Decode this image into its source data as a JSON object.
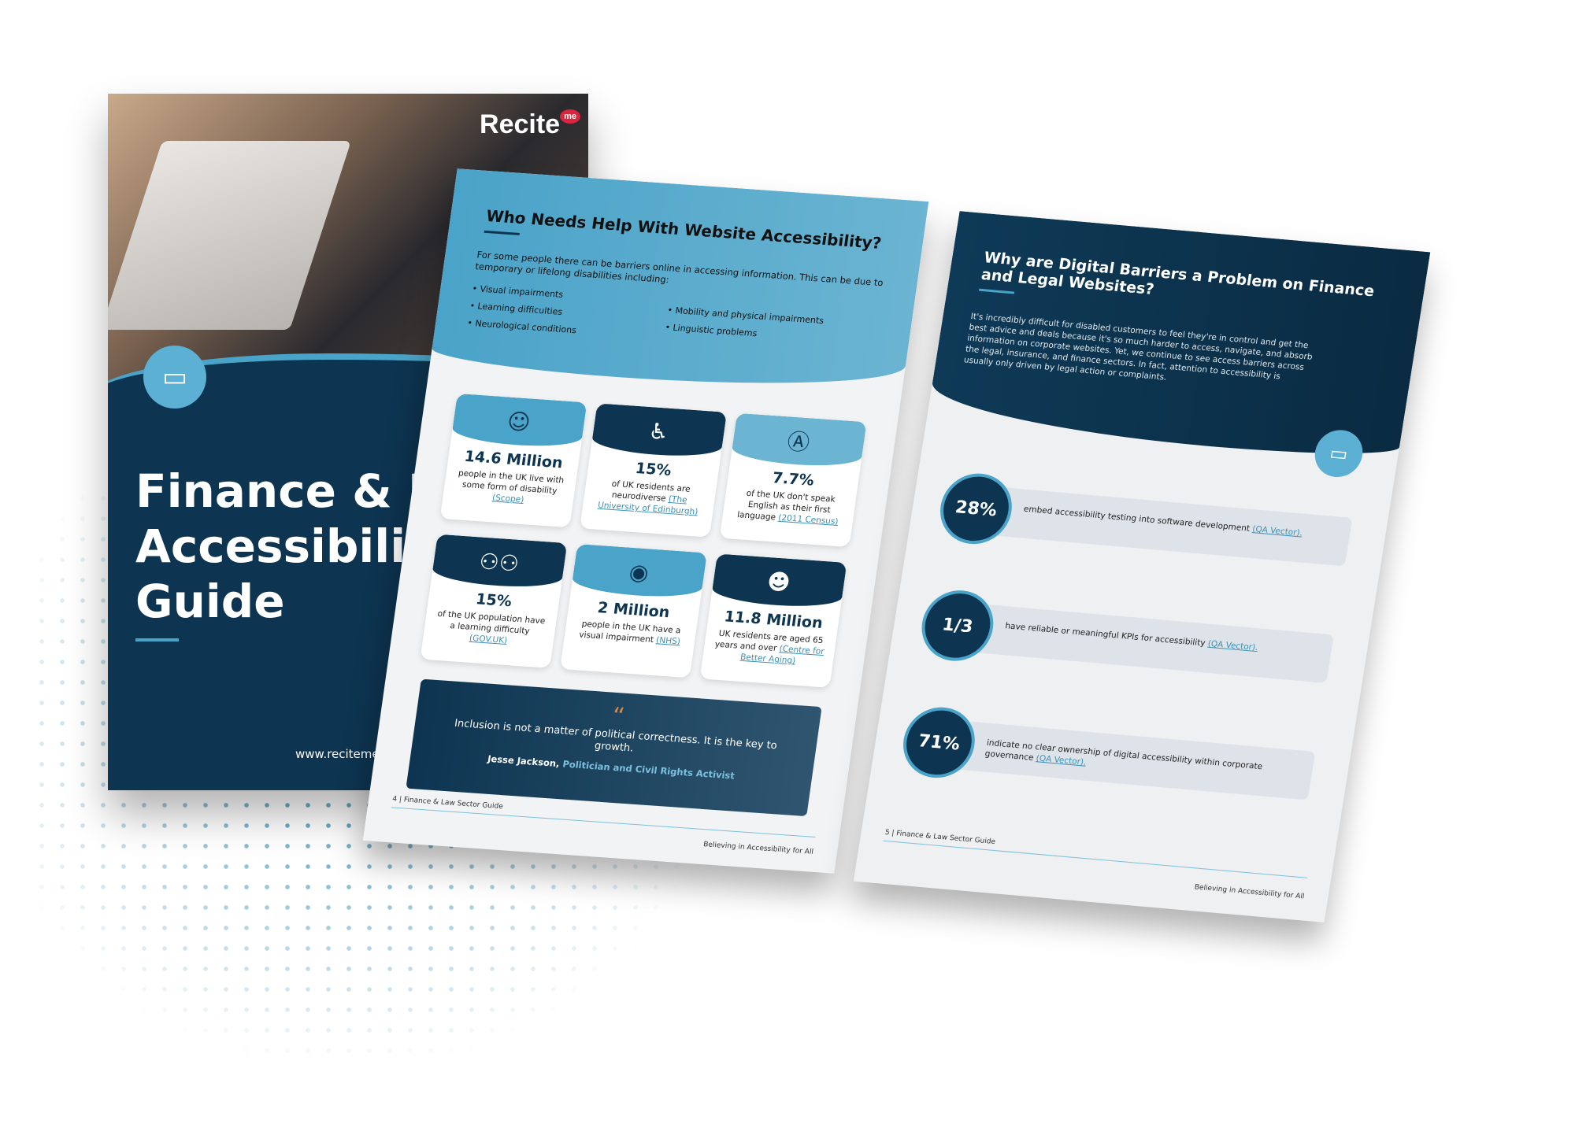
{
  "colors": {
    "navy": "#0d3450",
    "accent": "#4aa3c8",
    "quote_mark": "#d18a4a",
    "logo_red": "#d7263d"
  },
  "cover": {
    "logo": "Recite",
    "logo_badge": "me",
    "title": "Finance & L\nAccessibility\nGuide",
    "url": "www.reciteme.co",
    "badge_icon": "money-icon"
  },
  "left_page": {
    "title": "Who Needs Help With Website Accessibility?",
    "intro": "For some people there can be barriers online in accessing information. This can be due to temporary or lifelong disabilities including:",
    "bullets_col1": [
      "• Visual impairments",
      "• Learning difficulties",
      "• Neurological conditions"
    ],
    "bullets_col2": [
      "• Mobility and physical impairments",
      "• Linguistic problems"
    ],
    "stats": [
      {
        "value": "14.6 Million",
        "text": "people in the UK live with some form of disability",
        "source": "(Scope)",
        "icon": "brain-head-icon"
      },
      {
        "value": "15%",
        "text": "of UK residents are neurodiverse",
        "source": "(The University of Edinburgh)",
        "icon": "wheelchair-icon"
      },
      {
        "value": "7.7%",
        "text": "of the UK don't speak English as their first language",
        "source": "(2011 Census)",
        "icon": "speech-bubble-a-icon"
      },
      {
        "value": "15%",
        "text": "of the UK population have a learning difficulty",
        "source": "(GOV.UK)",
        "icon": "people-group-icon"
      },
      {
        "value": "2 Million",
        "text": "people in the UK have a visual impairment",
        "source": "(NHS)",
        "icon": "eye-slash-icon"
      },
      {
        "value": "11.8 Million",
        "text": "UK residents are aged 65 years and over",
        "source": "(Centre for Better Aging)",
        "icon": "elderly-person-icon"
      }
    ],
    "quote": {
      "mark": "“",
      "text": "Inclusion is not a matter of political correctness. It is the key to growth.",
      "author": "Jesse Jackson,",
      "role": "Politician and Civil Rights Activist"
    },
    "footer_left": "4 | Finance & Law Sector Guide",
    "footer_right": "Believing in Accessibility for All"
  },
  "right_page": {
    "title": "Why are Digital Barriers a Problem on Finance and Legal Websites?",
    "intro": "It's incredibly difficult for disabled customers to feel they're in control and get the best advice and deals because it's so much harder to access, navigate, and absorb information on corporate websites. Yet, we continue to see access barriers across the legal, insurance, and finance sectors. In fact, attention to accessibility is usually only driven by legal action or complaints.",
    "stats": [
      {
        "value": "28%",
        "text": "embed accessibility testing into software development",
        "source": "(QA Vector)."
      },
      {
        "value": "1/3",
        "text": "have reliable or meaningful KPIs for accessibility",
        "source": "(QA Vector)."
      },
      {
        "value": "71%",
        "text": "indicate no clear ownership of digital accessibility within corporate governance",
        "source": "(QA Vector)."
      }
    ],
    "footer_left": "5 | Finance & Law Sector Guide",
    "footer_right": "Believing in Accessibility for All"
  }
}
